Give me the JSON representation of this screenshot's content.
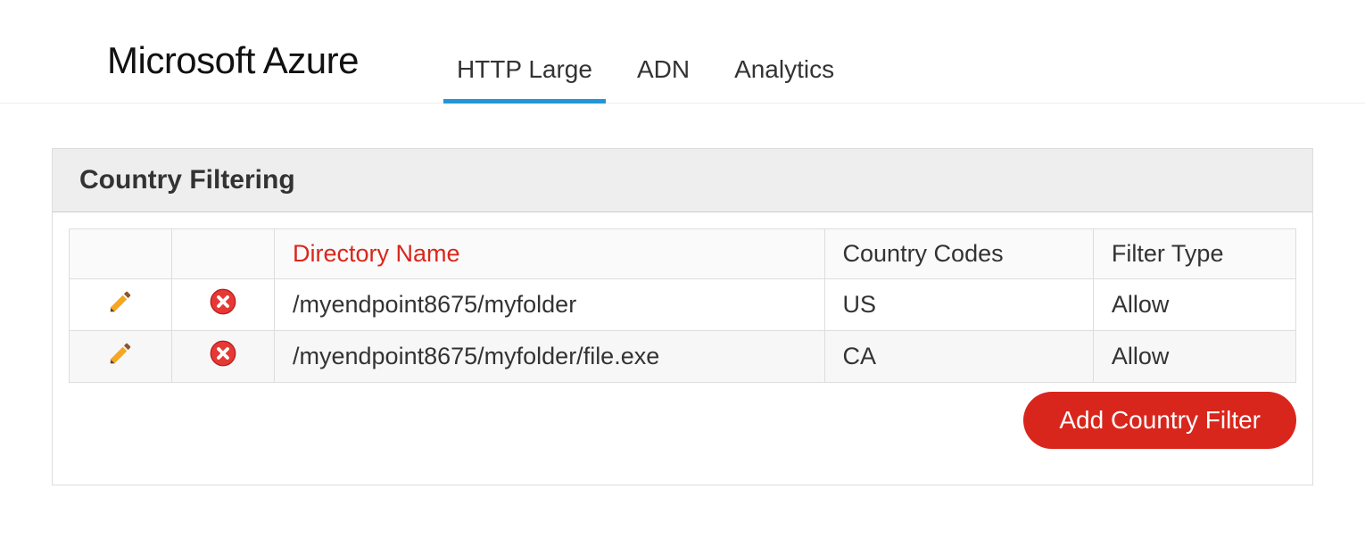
{
  "header": {
    "logo": "Microsoft Azure",
    "tabs": [
      "HTTP Large",
      "ADN",
      "Analytics"
    ],
    "active_tab_index": 0
  },
  "panel": {
    "title": "Country Filtering",
    "columns": {
      "directory": "Directory Name",
      "country_codes": "Country Codes",
      "filter_type": "Filter Type"
    },
    "rows": [
      {
        "directory": "/myendpoint8675/myfolder",
        "country_codes": "US",
        "filter_type": "Allow"
      },
      {
        "directory": "/myendpoint8675/myfolder/file.exe",
        "country_codes": "CA",
        "filter_type": "Allow"
      }
    ],
    "add_label": "Add Country Filter"
  },
  "icons": {
    "edit": "edit-icon",
    "delete": "delete-icon"
  }
}
